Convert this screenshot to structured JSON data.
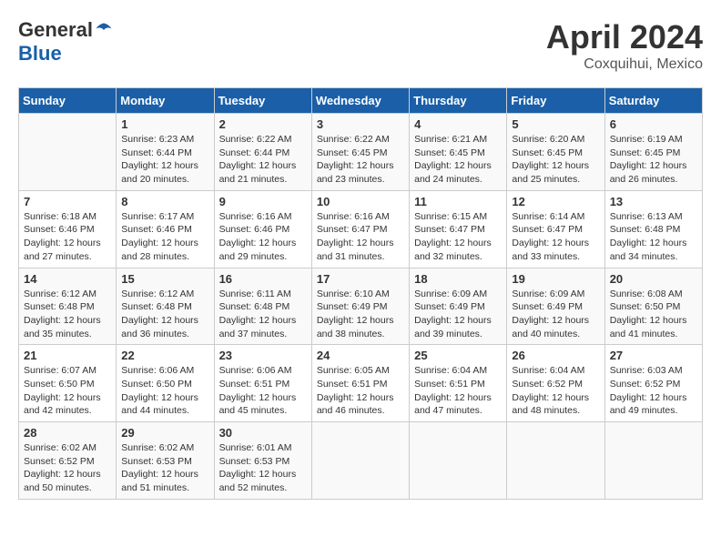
{
  "header": {
    "logo_general": "General",
    "logo_blue": "Blue",
    "month_title": "April 2024",
    "location": "Coxquihui, Mexico"
  },
  "calendar": {
    "weekdays": [
      "Sunday",
      "Monday",
      "Tuesday",
      "Wednesday",
      "Thursday",
      "Friday",
      "Saturday"
    ],
    "weeks": [
      [
        {
          "day": "",
          "info": ""
        },
        {
          "day": "1",
          "info": "Sunrise: 6:23 AM\nSunset: 6:44 PM\nDaylight: 12 hours\nand 20 minutes."
        },
        {
          "day": "2",
          "info": "Sunrise: 6:22 AM\nSunset: 6:44 PM\nDaylight: 12 hours\nand 21 minutes."
        },
        {
          "day": "3",
          "info": "Sunrise: 6:22 AM\nSunset: 6:45 PM\nDaylight: 12 hours\nand 23 minutes."
        },
        {
          "day": "4",
          "info": "Sunrise: 6:21 AM\nSunset: 6:45 PM\nDaylight: 12 hours\nand 24 minutes."
        },
        {
          "day": "5",
          "info": "Sunrise: 6:20 AM\nSunset: 6:45 PM\nDaylight: 12 hours\nand 25 minutes."
        },
        {
          "day": "6",
          "info": "Sunrise: 6:19 AM\nSunset: 6:45 PM\nDaylight: 12 hours\nand 26 minutes."
        }
      ],
      [
        {
          "day": "7",
          "info": "Sunrise: 6:18 AM\nSunset: 6:46 PM\nDaylight: 12 hours\nand 27 minutes."
        },
        {
          "day": "8",
          "info": "Sunrise: 6:17 AM\nSunset: 6:46 PM\nDaylight: 12 hours\nand 28 minutes."
        },
        {
          "day": "9",
          "info": "Sunrise: 6:16 AM\nSunset: 6:46 PM\nDaylight: 12 hours\nand 29 minutes."
        },
        {
          "day": "10",
          "info": "Sunrise: 6:16 AM\nSunset: 6:47 PM\nDaylight: 12 hours\nand 31 minutes."
        },
        {
          "day": "11",
          "info": "Sunrise: 6:15 AM\nSunset: 6:47 PM\nDaylight: 12 hours\nand 32 minutes."
        },
        {
          "day": "12",
          "info": "Sunrise: 6:14 AM\nSunset: 6:47 PM\nDaylight: 12 hours\nand 33 minutes."
        },
        {
          "day": "13",
          "info": "Sunrise: 6:13 AM\nSunset: 6:48 PM\nDaylight: 12 hours\nand 34 minutes."
        }
      ],
      [
        {
          "day": "14",
          "info": "Sunrise: 6:12 AM\nSunset: 6:48 PM\nDaylight: 12 hours\nand 35 minutes."
        },
        {
          "day": "15",
          "info": "Sunrise: 6:12 AM\nSunset: 6:48 PM\nDaylight: 12 hours\nand 36 minutes."
        },
        {
          "day": "16",
          "info": "Sunrise: 6:11 AM\nSunset: 6:48 PM\nDaylight: 12 hours\nand 37 minutes."
        },
        {
          "day": "17",
          "info": "Sunrise: 6:10 AM\nSunset: 6:49 PM\nDaylight: 12 hours\nand 38 minutes."
        },
        {
          "day": "18",
          "info": "Sunrise: 6:09 AM\nSunset: 6:49 PM\nDaylight: 12 hours\nand 39 minutes."
        },
        {
          "day": "19",
          "info": "Sunrise: 6:09 AM\nSunset: 6:49 PM\nDaylight: 12 hours\nand 40 minutes."
        },
        {
          "day": "20",
          "info": "Sunrise: 6:08 AM\nSunset: 6:50 PM\nDaylight: 12 hours\nand 41 minutes."
        }
      ],
      [
        {
          "day": "21",
          "info": "Sunrise: 6:07 AM\nSunset: 6:50 PM\nDaylight: 12 hours\nand 42 minutes."
        },
        {
          "day": "22",
          "info": "Sunrise: 6:06 AM\nSunset: 6:50 PM\nDaylight: 12 hours\nand 44 minutes."
        },
        {
          "day": "23",
          "info": "Sunrise: 6:06 AM\nSunset: 6:51 PM\nDaylight: 12 hours\nand 45 minutes."
        },
        {
          "day": "24",
          "info": "Sunrise: 6:05 AM\nSunset: 6:51 PM\nDaylight: 12 hours\nand 46 minutes."
        },
        {
          "day": "25",
          "info": "Sunrise: 6:04 AM\nSunset: 6:51 PM\nDaylight: 12 hours\nand 47 minutes."
        },
        {
          "day": "26",
          "info": "Sunrise: 6:04 AM\nSunset: 6:52 PM\nDaylight: 12 hours\nand 48 minutes."
        },
        {
          "day": "27",
          "info": "Sunrise: 6:03 AM\nSunset: 6:52 PM\nDaylight: 12 hours\nand 49 minutes."
        }
      ],
      [
        {
          "day": "28",
          "info": "Sunrise: 6:02 AM\nSunset: 6:52 PM\nDaylight: 12 hours\nand 50 minutes."
        },
        {
          "day": "29",
          "info": "Sunrise: 6:02 AM\nSunset: 6:53 PM\nDaylight: 12 hours\nand 51 minutes."
        },
        {
          "day": "30",
          "info": "Sunrise: 6:01 AM\nSunset: 6:53 PM\nDaylight: 12 hours\nand 52 minutes."
        },
        {
          "day": "",
          "info": ""
        },
        {
          "day": "",
          "info": ""
        },
        {
          "day": "",
          "info": ""
        },
        {
          "day": "",
          "info": ""
        }
      ]
    ]
  }
}
